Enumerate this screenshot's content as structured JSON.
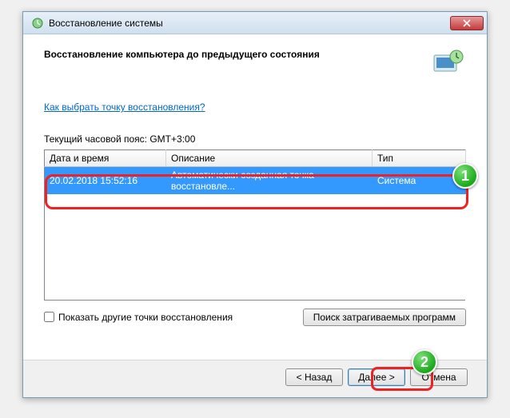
{
  "window": {
    "title": "Восстановление системы"
  },
  "header": {
    "title": "Восстановление компьютера до предыдущего состояния"
  },
  "help_link": "Как выбрать точку восстановления?",
  "timezone_text": "Текущий часовой пояс: GMT+3:00",
  "table": {
    "headers": {
      "date": "Дата и время",
      "desc": "Описание",
      "type": "Тип"
    },
    "rows": [
      {
        "date": "20.02.2018 15:52:16",
        "desc": "Автоматически созданная точка восстановле...",
        "type": "Система"
      }
    ]
  },
  "checkbox_label": "Показать другие точки восстановления",
  "buttons": {
    "scan": "Поиск затрагиваемых программ",
    "back": "< Назад",
    "next": "Далее >",
    "cancel": "Отмена"
  },
  "callouts": {
    "one": "1",
    "two": "2"
  }
}
